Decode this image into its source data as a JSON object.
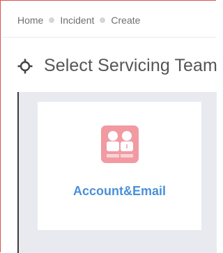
{
  "breadcrumb": {
    "items": [
      "Home",
      "Incident",
      "Create"
    ]
  },
  "page": {
    "title": "Select Servicing Team",
    "icon": "crosshair-icon"
  },
  "teams": [
    {
      "name": "Account&Email",
      "icon": "team-users-icon",
      "icon_color": "#f19aa2",
      "label_color": "#4a90d9"
    }
  ],
  "colors": {
    "frame_border": "#d9534f",
    "content_bg": "#e9eaf0"
  }
}
